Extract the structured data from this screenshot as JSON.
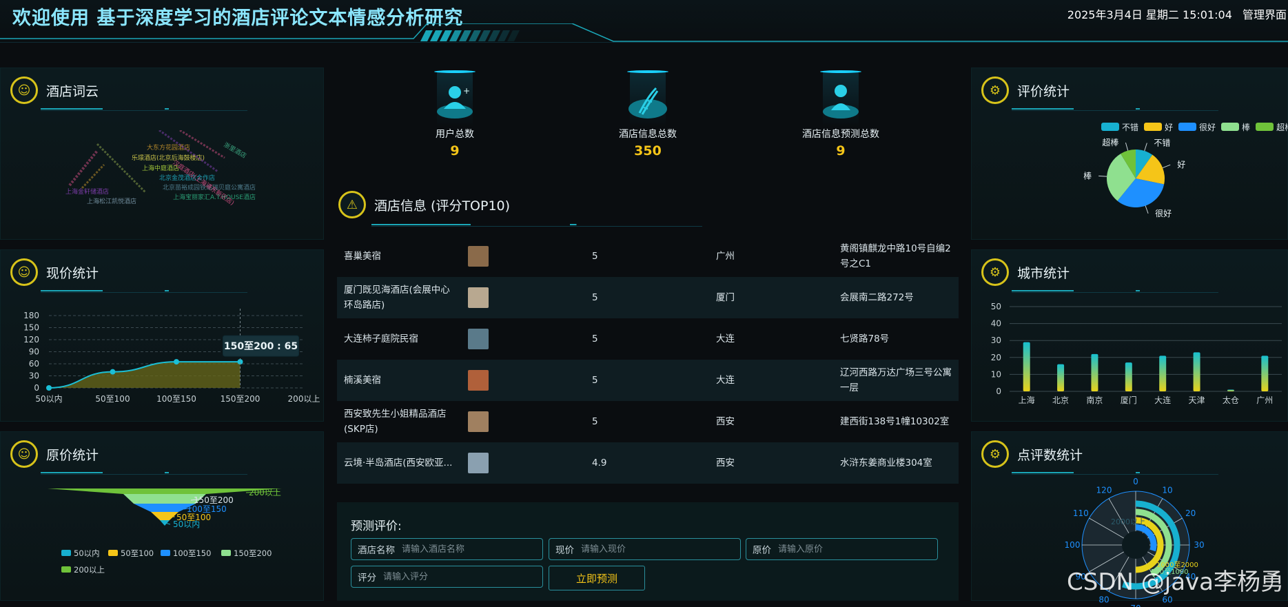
{
  "header": {
    "title": "欢迎使用 基于深度学习的酒店评论文本情感分析研究",
    "datetime": "2025年3月4日 星期二 15:01:04",
    "admin_link": "管理界面"
  },
  "panels": {
    "wordcloud": {
      "title": "酒店词云"
    },
    "current_price": {
      "title": "现价统计"
    },
    "original_price": {
      "title": "原价统计"
    },
    "rating": {
      "title": "评价统计"
    },
    "city": {
      "title": "城市统计"
    },
    "review_count": {
      "title": "点评数统计"
    },
    "hotel_list": {
      "title": "酒店信息 (评分TOP10)"
    }
  },
  "wordcloud_words": [
    {
      "text": "大东方花园酒店",
      "color": "#b88a2a"
    },
    {
      "text": "乐璟酒店(北京后海鼓楼店)",
      "color": "#c9c24a"
    },
    {
      "text": "上海中庭酒店",
      "color": "#a0c43a"
    },
    {
      "text": "北京金茂酒店合作店",
      "color": "#1e9cb0"
    },
    {
      "text": "北京苗裕成园铁站瑞贝庭公寓酒店",
      "color": "#4d7a8a"
    },
    {
      "text": "上海金轩储酒店",
      "color": "#7b3da8"
    },
    {
      "text": "上海宝丽家汇A.T.HOUSE酒店",
      "color": "#2a9c74"
    },
    {
      "text": "上海松江凯悦酒店",
      "color": "#6e8a9a"
    },
    {
      "text": "汉庭酒店(上海浦东新区店)",
      "color": "#c24a7a"
    },
    {
      "text": "浙里酒店",
      "color": "#3aa07c"
    }
  ],
  "stats": [
    {
      "label": "用户总数",
      "value": "9",
      "icon": "user-plus-icon"
    },
    {
      "label": "酒店信息总数",
      "value": "350",
      "icon": "dna-icon"
    },
    {
      "label": "酒店信息预测总数",
      "value": "9",
      "icon": "user-icon"
    }
  ],
  "hotels": [
    {
      "name": "喜巢美宿",
      "score": "5",
      "city": "广州",
      "address": "黄阁镇麒龙中路10号自编2号之C1",
      "thumb": "#8a6a4a"
    },
    {
      "name": "厦门既见海酒店(会展中心环岛路店)",
      "score": "5",
      "city": "厦门",
      "address": "会展南二路272号",
      "thumb": "#b8a890"
    },
    {
      "name": "大连柿子庭院民宿",
      "score": "5",
      "city": "大连",
      "address": "七贤路78号",
      "thumb": "#5a7a8a"
    },
    {
      "name": "楠溪美宿",
      "score": "5",
      "city": "大连",
      "address": "辽河西路万达广场三号公寓一层",
      "thumb": "#b0603a"
    },
    {
      "name": "西安致先生小姐精品酒店(SKP店)",
      "score": "5",
      "city": "西安",
      "address": "建西街138号1幢10302室",
      "thumb": "#a08060"
    },
    {
      "name": "云境·半岛酒店(西安欧亚...",
      "score": "4.9",
      "city": "西安",
      "address": "水浒东姜商业楼304室",
      "thumb": "#8aa0b0"
    }
  ],
  "prediction": {
    "title": "预测评价:",
    "fields": [
      {
        "label": "酒店名称",
        "placeholder": "请输入酒店名称"
      },
      {
        "label": "现价",
        "placeholder": "请输入现价"
      },
      {
        "label": "原价",
        "placeholder": "请输入原价"
      },
      {
        "label": "评分",
        "placeholder": "请输入评分"
      }
    ],
    "submit": "立即预测"
  },
  "watermark": "CSDN @java李杨勇",
  "chart_data": [
    {
      "type": "area",
      "id": "current_price",
      "categories": [
        "50以内",
        "50至100",
        "100至150",
        "150至200",
        "200以上"
      ],
      "values": [
        0,
        40,
        65,
        65,
        null
      ],
      "yticks": [
        0,
        30,
        60,
        90,
        120,
        150,
        180
      ],
      "ylim": [
        0,
        180
      ],
      "tooltip": "150至200 : 65",
      "colors": {
        "line": "#1bbfd6",
        "area": "#6b6a1a"
      }
    },
    {
      "type": "funnel",
      "id": "original_price",
      "labels": [
        "200以上",
        "150至200",
        "100至150",
        "50至100",
        "50以内"
      ],
      "legend": [
        "50以内",
        "50至100",
        "100至150",
        "150至200",
        "200以上"
      ],
      "colors": [
        "#6fc23a",
        "#8fe08f",
        "#1e90ff",
        "#f5c518",
        "#17b0d0"
      ]
    },
    {
      "type": "pie",
      "id": "rating",
      "labels": [
        "不错",
        "好",
        "很好",
        "棒",
        "超棒"
      ],
      "values": [
        9,
        17,
        30,
        28,
        8
      ],
      "colors": [
        "#17b0d0",
        "#f5c518",
        "#1e90ff",
        "#8fe08f",
        "#6fc23a"
      ]
    },
    {
      "type": "bar",
      "id": "city",
      "categories": [
        "上海",
        "北京",
        "南京",
        "厦门",
        "大连",
        "天津",
        "太仓",
        "广州"
      ],
      "values": [
        29,
        16,
        22,
        17,
        21,
        23,
        1,
        21
      ],
      "ylim": [
        0,
        50
      ],
      "yticks": [
        0,
        10,
        20,
        30,
        40,
        50
      ]
    },
    {
      "type": "polar-bar",
      "id": "review_count",
      "ticks": [
        "0",
        "10",
        "20",
        "30",
        "40",
        "60",
        "70",
        "80",
        "90",
        "100",
        "110",
        "120"
      ],
      "overlay_labels": [
        "2000以上",
        "1000至2000",
        "500至1000"
      ]
    }
  ]
}
